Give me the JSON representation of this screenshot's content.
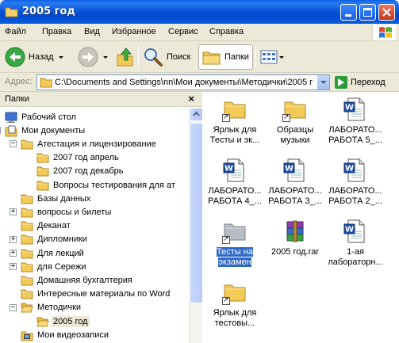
{
  "window": {
    "title": "2005 год"
  },
  "menu": [
    "Файл",
    "Правка",
    "Вид",
    "Избранное",
    "Сервис",
    "Справка"
  ],
  "toolbar": {
    "back_label": "Назад",
    "search_label": "Поиск",
    "folders_label": "Папки"
  },
  "address": {
    "label": "Адрес:",
    "path": "C:\\Documents and Settings\\nn\\Мои документы\\Методички\\2005 г",
    "go_label": "Переход"
  },
  "folders_pane": {
    "title": "Папки",
    "items": [
      {
        "label": "Рабочий стол",
        "icon": "desktop-icon"
      },
      {
        "label": "Мои документы",
        "icon": "my-documents-icon",
        "expander": "−"
      },
      {
        "label": "Атестация и лицензирование",
        "icon": "folder-icon",
        "expander": "−"
      },
      {
        "label": "2007 год апрель",
        "icon": "folder-icon"
      },
      {
        "label": "2007 год декабрь",
        "icon": "folder-icon"
      },
      {
        "label": "Вопросы тестирования для ат",
        "icon": "folder-icon"
      },
      {
        "label": "Базы данных",
        "icon": "folder-icon"
      },
      {
        "label": "вопросы и билеты",
        "icon": "folder-icon",
        "expander": "+"
      },
      {
        "label": "Деканат",
        "icon": "folder-icon"
      },
      {
        "label": "Дипломники",
        "icon": "folder-icon",
        "expander": "+"
      },
      {
        "label": "Для лекций",
        "icon": "folder-icon",
        "expander": "+"
      },
      {
        "label": "для Сережи",
        "icon": "folder-icon",
        "expander": "+"
      },
      {
        "label": "Домашняя бухгалтерия",
        "icon": "folder-icon"
      },
      {
        "label": "Интересные материалы по Word",
        "icon": "folder-icon"
      },
      {
        "label": "Методички",
        "icon": "folder-open-icon",
        "expander": "−"
      },
      {
        "label": "2005 год",
        "icon": "folder-open-icon",
        "selected": true
      },
      {
        "label": "Мои видеозаписи",
        "icon": "video-folder-icon"
      }
    ]
  },
  "files": [
    {
      "line1": "Ярлык для",
      "line2": "Тесты и эк...",
      "icon": "folder-shortcut-icon"
    },
    {
      "line1": "Образцы",
      "line2": "музыки",
      "icon": "folder-shortcut-icon"
    },
    {
      "line1": "ЛАБОРАТО...",
      "line2": "РАБОТА 5_...",
      "icon": "word-doc-icon"
    },
    {
      "line1": "ЛАБОРАТО...",
      "line2": "РАБОТА 4_...",
      "icon": "word-doc-icon"
    },
    {
      "line1": "ЛАБОРАТО...",
      "line2": "РАБОТА 3_...",
      "icon": "word-doc-icon"
    },
    {
      "line1": "ЛАБОРАТО...",
      "line2": "РАБОТА 2_...",
      "icon": "word-doc-icon"
    },
    {
      "line1": "Тесты на",
      "line2": "экзамен",
      "icon": "folder-shortcut-gray-icon",
      "selected": true
    },
    {
      "line1": "2005 год.rar",
      "line2": "",
      "icon": "winrar-archive-icon"
    },
    {
      "line1": "1-ая",
      "line2": "лабораторн...",
      "icon": "word-doc-icon"
    },
    {
      "line1": "Ярлык для",
      "line2": "тестовы...",
      "icon": "folder-shortcut-icon"
    }
  ]
}
